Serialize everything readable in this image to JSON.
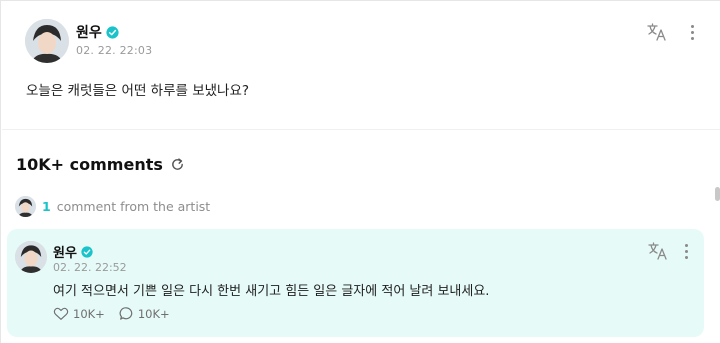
{
  "post": {
    "author": "원우",
    "timestamp": "02. 22. 22:03",
    "text": "오늘은 캐럿들은 어떤 하루를 보냈나요?"
  },
  "comments_section": {
    "title": "10K+ comments",
    "artist_comment_count": "1",
    "artist_comment_label": "comment from the artist"
  },
  "artist_comment": {
    "author": "원우",
    "timestamp": "02. 22. 22:52",
    "text": "여기 적으면서 기쁜 일은 다시 한번 새기고 힘든 일은 글자에 적어 날려 보내세요.",
    "likes": "10K+",
    "replies": "10K+"
  },
  "icons": {
    "verified": "verified-badge-icon",
    "translate": "translate-icon",
    "more": "more-vertical-icon",
    "refresh": "refresh-icon",
    "like": "heart-icon",
    "reply": "speech-bubble-icon"
  },
  "colors": {
    "accent": "#19c3c9",
    "comment_bg": "#e6fbf8"
  }
}
